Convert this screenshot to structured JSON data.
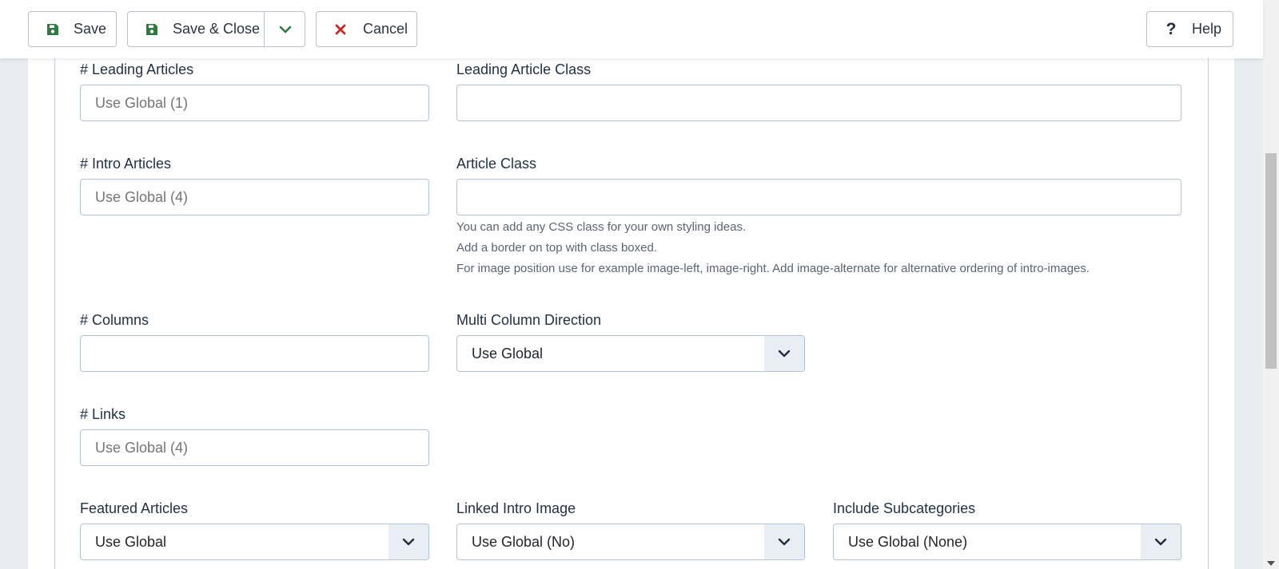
{
  "toolbar": {
    "save_label": "Save",
    "save_close_label": "Save & Close",
    "cancel_label": "Cancel",
    "help_label": "Help"
  },
  "fields": {
    "leading_articles": {
      "label": "# Leading Articles",
      "placeholder": "Use Global (1)"
    },
    "leading_article_class": {
      "label": "Leading Article Class",
      "value": ""
    },
    "intro_articles": {
      "label": "# Intro Articles",
      "placeholder": "Use Global (4)"
    },
    "article_class": {
      "label": "Article Class",
      "value": "",
      "help": [
        "You can add any CSS class for your own styling ideas.",
        "Add a border on top with class boxed.",
        "For image position use for example image-left, image-right. Add image-alternate for alternative ordering of intro-images."
      ]
    },
    "columns": {
      "label": "# Columns",
      "value": ""
    },
    "multi_column_direction": {
      "label": "Multi Column Direction",
      "selected": "Use Global"
    },
    "links": {
      "label": "# Links",
      "placeholder": "Use Global (4)"
    },
    "featured_articles": {
      "label": "Featured Articles",
      "selected": "Use Global"
    },
    "linked_intro_image": {
      "label": "Linked Intro Image",
      "selected": "Use Global (No)"
    },
    "include_subcategories": {
      "label": "Include Subcategories",
      "selected": "Use Global (None)"
    }
  },
  "colors": {
    "save_icon": "#2f7a40",
    "cancel_icon": "#c52827",
    "label_text": "#1f3045",
    "border": "#b3c2d4"
  },
  "icons": {
    "save": "floppy-disk-icon",
    "save_close": "floppy-disk-icon",
    "dropdown": "chevron-down-icon",
    "cancel": "x-icon",
    "help": "question-mark-icon"
  }
}
